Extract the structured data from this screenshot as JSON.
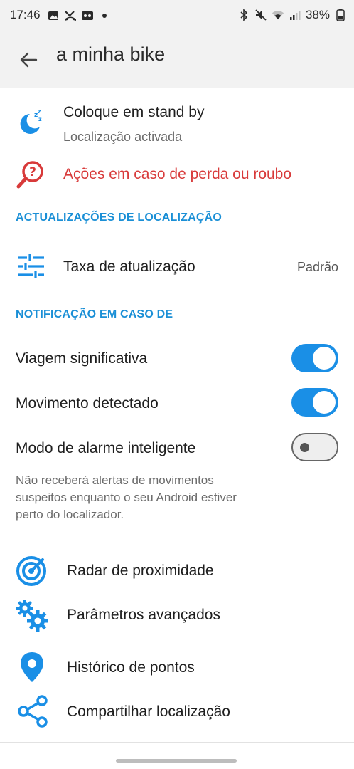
{
  "status_bar": {
    "time": "17:46",
    "battery": "38%",
    "left_icons": [
      "gallery-icon",
      "missed-call-icon",
      "voicemail-icon",
      "dot-icon"
    ],
    "right_icons": [
      "bluetooth-icon",
      "mute-icon",
      "wifi-icon",
      "signal-icon",
      "battery-icon"
    ]
  },
  "header": {
    "title": "a minha bike",
    "back_icon": "arrow-back-icon"
  },
  "standby": {
    "title": "Coloque em stand by",
    "subtitle": "Localização activada",
    "icon": "moon-sleep-icon"
  },
  "loss": {
    "label": "Ações em caso de perda ou roubo",
    "icon": "search-question-icon"
  },
  "location_updates": {
    "section_title": "ACTUALIZAÇÕES DE LOCALIZAÇÃO",
    "rate_label": "Taxa de atualização",
    "rate_value": "Padrão",
    "icon": "sliders-icon"
  },
  "notifications": {
    "section_title": "NOTIFICAÇÃO EM CASO DE",
    "items": [
      {
        "label": "Viagem significativa",
        "enabled": true
      },
      {
        "label": "Movimento detectado",
        "enabled": true
      },
      {
        "label": "Modo de alarme inteligente",
        "enabled": false
      }
    ],
    "hint": "Não receberá alertas de movimentos\nsuspeitos enquanto o seu Android estiver\nperto do localizador."
  },
  "menu": [
    {
      "label": "Radar de proximidade",
      "icon": "radar-icon"
    },
    {
      "label": "Parâmetros avançados",
      "icon": "gears-icon"
    },
    {
      "label": "Histórico de pontos",
      "icon": "location-pin-icon"
    },
    {
      "label": "Compartilhar localização",
      "icon": "share-icon"
    }
  ],
  "colors": {
    "accent": "#1a8fe6",
    "section": "#1a8fd6",
    "danger": "#d83a3a",
    "bar_bg": "#f2f2f2"
  }
}
